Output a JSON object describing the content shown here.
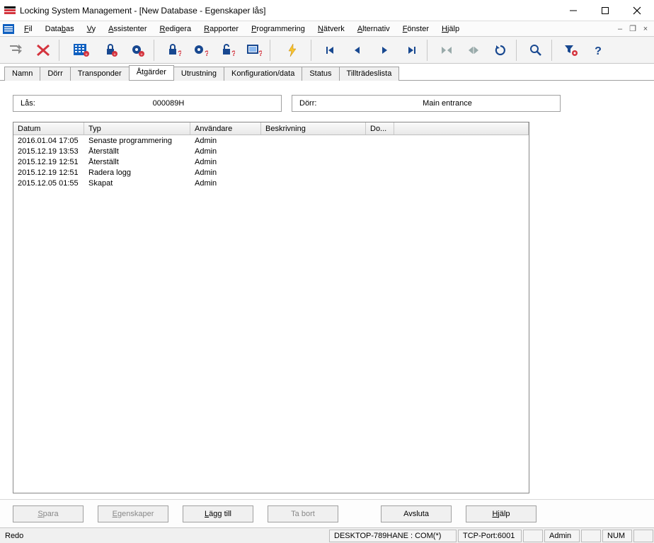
{
  "window": {
    "title": "Locking System Management - [New Database - Egenskaper lås]"
  },
  "menu": {
    "fil": "Fil",
    "databas": "Databas",
    "vy": "Vy",
    "assistenter": "Assistenter",
    "redigera": "Redigera",
    "rapporter": "Rapporter",
    "programmering": "Programmering",
    "natverk": "Nätverk",
    "alternativ": "Alternativ",
    "fonster": "Fönster",
    "hjalp": "Hjälp"
  },
  "tabs": {
    "namn": "Namn",
    "dorr": "Dörr",
    "transponder": "Transponder",
    "atgarder": "Åtgärder",
    "utrustning": "Utrustning",
    "konfiguration": "Konfiguration/data",
    "status": "Status",
    "tilltrades": "Tillträdeslista"
  },
  "info": {
    "lock_label": "Lås:",
    "lock_value": "000089H",
    "door_label": "Dörr:",
    "door_value": "Main entrance"
  },
  "table": {
    "headers": {
      "datum": "Datum",
      "typ": "Typ",
      "anvandare": "Användare",
      "beskrivning": "Beskrivning",
      "do": "Do..."
    },
    "rows": [
      {
        "datum": "2016.01.04 17:05",
        "typ": "Senaste programmering",
        "anvandare": "Admin",
        "beskrivning": "",
        "do": ""
      },
      {
        "datum": "2015.12.19 13:53",
        "typ": "Återställt",
        "anvandare": "Admin",
        "beskrivning": "",
        "do": ""
      },
      {
        "datum": "2015.12.19 12:51",
        "typ": "Återställt",
        "anvandare": "Admin",
        "beskrivning": "",
        "do": ""
      },
      {
        "datum": "2015.12.19 12:51",
        "typ": "Radera logg",
        "anvandare": "Admin",
        "beskrivning": "",
        "do": ""
      },
      {
        "datum": "2015.12.05 01:55",
        "typ": "Skapat",
        "anvandare": "Admin",
        "beskrivning": "",
        "do": ""
      }
    ]
  },
  "buttons": {
    "spara": "Spara",
    "egenskaper": "Egenskaper",
    "lagg_till": "Lägg till",
    "ta_bort": "Ta bort",
    "avsluta": "Avsluta",
    "hjalp": "Hjälp"
  },
  "status": {
    "redo": "Redo",
    "desktop": "DESKTOP-789HANE : COM(*)",
    "tcp": "TCP-Port:6001",
    "admin": "Admin",
    "num": "NUM"
  }
}
